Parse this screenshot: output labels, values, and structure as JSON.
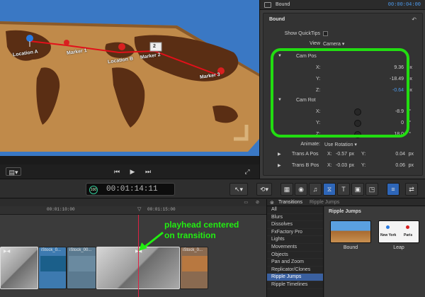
{
  "viewer": {
    "map_labels": [
      "Location A",
      "Marker 1",
      "Location B",
      "Marker 2",
      "Marker 3"
    ],
    "marker_number": "2"
  },
  "inspector": {
    "title": "Bound",
    "timecode": "00:00:04:00",
    "section": "Bound",
    "show_quicktips_label": "Show QuickTips",
    "view_label": "View",
    "view_value": "Camera",
    "cam_pos_label": "Cam Pos",
    "cam_pos": [
      {
        "axis": "X:",
        "value": "9.36",
        "unit": "px"
      },
      {
        "axis": "Y:",
        "value": "-18.49",
        "unit": "px"
      },
      {
        "axis": "Z:",
        "value": "-0.64",
        "unit": "px"
      }
    ],
    "cam_rot_label": "Cam Rot",
    "cam_rot": [
      {
        "axis": "X:",
        "value": "-8.9",
        "unit": "°"
      },
      {
        "axis": "Y:",
        "value": "0",
        "unit": "°"
      },
      {
        "axis": "Z:",
        "value": "18.0",
        "unit": "°"
      }
    ],
    "animate_label": "Animate:",
    "animate_value": "Use Rotation",
    "trans_a_label": "Trans A Pos",
    "trans_a_x_label": "X:",
    "trans_a_x": "-0.57",
    "trans_a_y_label": "Y:",
    "trans_a_y": "0.04",
    "trans_b_label": "Trans B Pos",
    "trans_b_x_label": "X:",
    "trans_b_x": "-0.03",
    "trans_b_y_label": "Y:",
    "trans_b_y": "0.06",
    "unit_px": "px"
  },
  "toolbar": {
    "zoom_percent": "100",
    "timecode": "00:01:14:11"
  },
  "timeline": {
    "ruler_ticks": [
      "00:01:10:00",
      "00:01:15:00"
    ],
    "clips": [
      "iStock_0...",
      "iStock_00...",
      "iStock_0..."
    ],
    "annotation_line1": "playhead centered",
    "annotation_line2": "on transition"
  },
  "browser": {
    "header_title": "Transitions",
    "header_path": "Ripple Jumps",
    "categories": [
      "All",
      "Blurs",
      "Dissolves",
      "FxFactory Pro",
      "Lights",
      "Movements",
      "Objects",
      "Pan and Zoom",
      "Replicator/Clones",
      "Ripple Jumps",
      "Ripple Timelines"
    ],
    "selected_category": "Ripple Jumps",
    "group_title": "Ripple Jumps",
    "items": [
      {
        "label": "Bound"
      },
      {
        "label": "Leap",
        "thumb_text_1": "New York",
        "thumb_text_2": "Paris"
      }
    ]
  },
  "colors": {
    "accent_blue": "#4d9cf0",
    "highlight_green": "#22dd11",
    "selection": "#3a60a0"
  }
}
